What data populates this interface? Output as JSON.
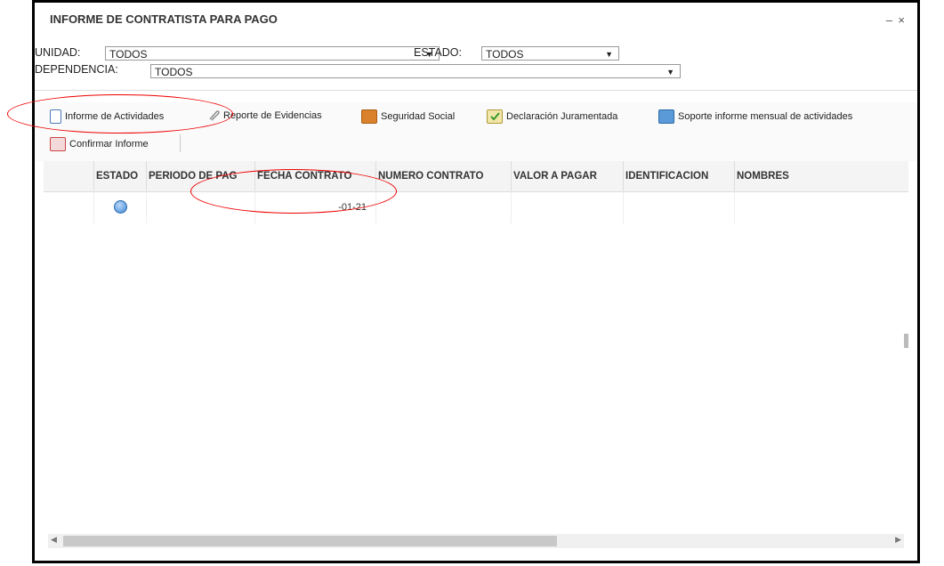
{
  "window": {
    "title": "INFORME DE CONTRATISTA PARA PAGO",
    "minimize": "–",
    "close": "×"
  },
  "filters": {
    "unidad_label": "UNIDAD:",
    "unidad_value": "TODOS",
    "estado_label": "ESTADO:",
    "estado_value": "TODOS",
    "dependencia_label": "DEPENDENCIA:",
    "dependencia_value": "TODOS",
    "caret": "▼"
  },
  "toolbar": {
    "informe_actividades": "Informe de Actividades",
    "reporte_evidencias": "Reporte de Evidencias",
    "seguridad_social": "Seguridad Social",
    "declaracion_juramentada": "Declaración Juramentada",
    "soporte_informe": "Soporte informe mensual de actividades",
    "confirmar_informe": "Confirmar Informe"
  },
  "grid": {
    "columns": [
      "ESTADO",
      "PERIODO DE PAG",
      "FECHA CONTRATO",
      "NUMERO CONTRATO",
      "VALOR A PAGAR",
      "IDENTIFICACION",
      "NOMBRES"
    ],
    "rows": [
      {
        "estado": "circle",
        "periodo": "",
        "fecha_contrato": "-01-21",
        "numero": "",
        "valor": "",
        "identificacion": "",
        "nombres": ""
      }
    ]
  },
  "scroll": {
    "left_arrow": "◀",
    "right_arrow": "▶"
  },
  "colors": {
    "highlight_oval": "#ee0000",
    "status_circle": "#3a86d6"
  },
  "icons": {
    "informe_actividades": "document-icon",
    "reporte_evidencias": "paperclip-icon",
    "seguridad_social": "folder-icon",
    "declaracion_juramentada": "checked-document-icon",
    "soporte_informe": "book-icon",
    "confirmar_informe": "edit-form-icon"
  }
}
